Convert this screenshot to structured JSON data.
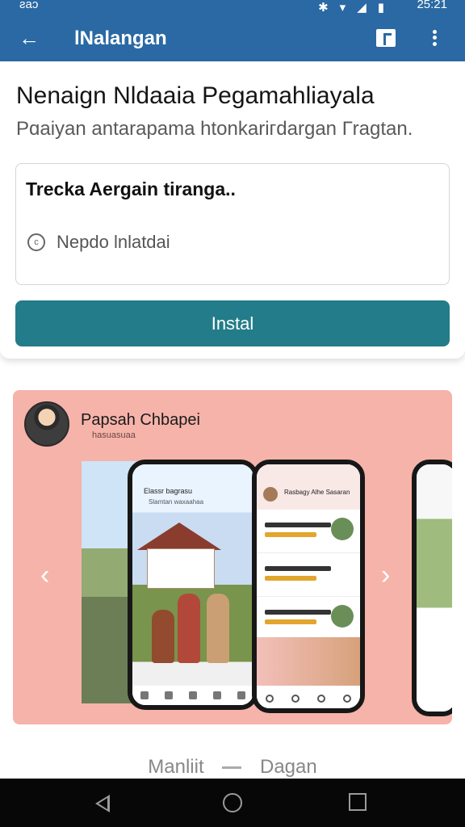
{
  "status_bar": {
    "time_left": "ƨaɔ",
    "time_right": "25:21",
    "icons": [
      "bluetooth-icon",
      "wifi-icon",
      "signal-icon",
      "battery-icon"
    ]
  },
  "app_bar": {
    "title": "lNalangan",
    "actions": [
      "back-icon",
      "document-icon",
      "more-icon"
    ]
  },
  "main": {
    "headline": "Nenaign Nldaaia Pegamahliayala",
    "subhead": "Pɑaiyan antarapama htonkariгdargan Гragtan.",
    "info_box": {
      "title": "Trecka Aergain tiranga..",
      "row": {
        "icon": "copyright-circle-icon",
        "text": "Nepdo lnlatdai"
      }
    },
    "install_label": "Instal"
  },
  "promo": {
    "title": "Papsah Chbapei",
    "subtitle": "hasuasuaa",
    "phone_a": {
      "header": "Elassr bagrasu",
      "subheader": "Slamtan waxaahaa"
    },
    "phone_b": {
      "header": "Rasbagy Alhe Sasaran"
    }
  },
  "pager": {
    "left": "Manliit",
    "right": "Dagan"
  },
  "system_nav": [
    "back-nav-icon",
    "home-nav-icon",
    "recents-nav-icon"
  ],
  "colors": {
    "app_bar": "#2a69a4",
    "install_button": "#237c89",
    "promo_background": "#f6b3aa"
  }
}
